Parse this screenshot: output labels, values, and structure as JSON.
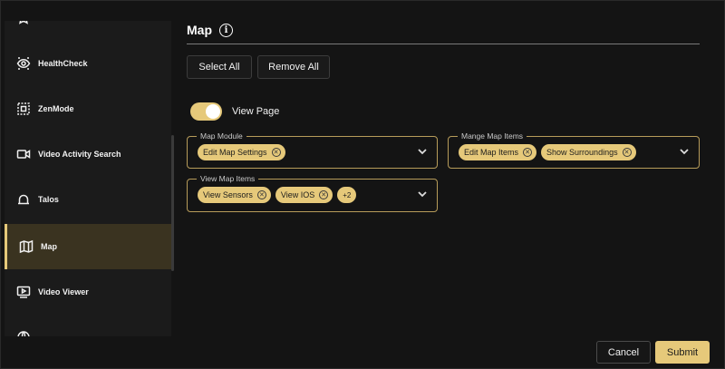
{
  "sidebar": {
    "items": [
      {
        "label": "",
        "icon": "star-icon"
      },
      {
        "label": "HealthCheck",
        "icon": "eye-scan-icon"
      },
      {
        "label": "ZenMode",
        "icon": "grid-dots-icon"
      },
      {
        "label": "Video Activity Search",
        "icon": "video-camera-icon"
      },
      {
        "label": "Talos",
        "icon": "bell-dome-icon"
      },
      {
        "label": "Map",
        "icon": "map-icon",
        "active": true
      },
      {
        "label": "Video Viewer",
        "icon": "play-screen-icon"
      },
      {
        "label": "",
        "icon": "globe-icon"
      }
    ]
  },
  "main": {
    "title": "Map",
    "select_all": "Select All",
    "remove_all": "Remove All",
    "view_page_label": "View Page",
    "view_page_enabled": true,
    "fields": {
      "map_module": {
        "legend": "Map Module",
        "chips": [
          "Edit Map Settings"
        ]
      },
      "manage_map_items": {
        "legend": "Mange Map Items",
        "chips": [
          "Edit Map Items",
          "Show Surroundings"
        ]
      },
      "view_map_items": {
        "legend": "View Map Items",
        "chips": [
          "View Sensors",
          "View IOS"
        ],
        "more": "+2"
      }
    }
  },
  "footer": {
    "cancel": "Cancel",
    "submit": "Submit"
  },
  "colors": {
    "accent": "#e6c97a",
    "background": "#141414",
    "sidebar": "#1b1b1b",
    "active_item": "#3a3320"
  }
}
